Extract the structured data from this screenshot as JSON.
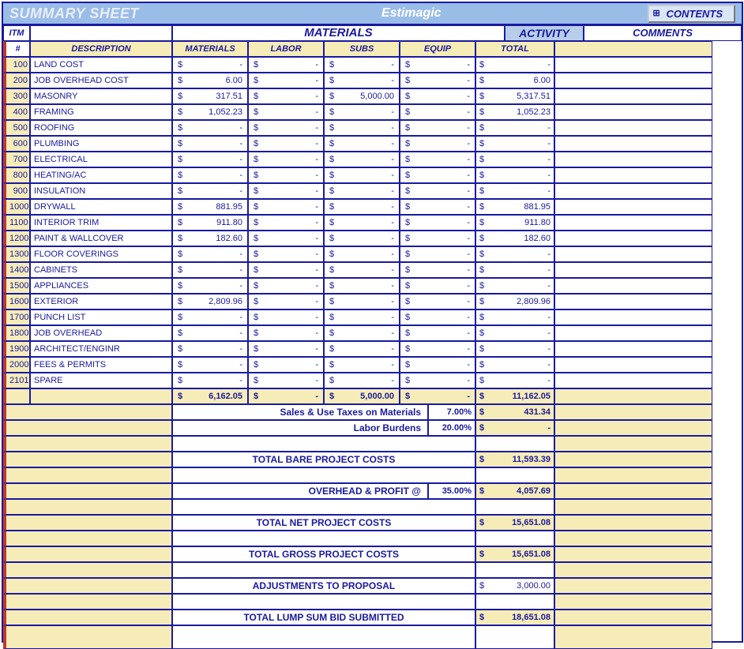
{
  "header": {
    "title": "SUMMARY SHEET",
    "app": "Estimagic",
    "button": "CONTENTS"
  },
  "colheads": {
    "itm": "ITM",
    "materials": "MATERIALS",
    "activity": "ACTIVITY",
    "comments": "COMMENTS",
    "num": "#",
    "desc": "DESCRIPTION",
    "c1": "MATERIALS",
    "c2": "LABOR",
    "c3": "SUBS",
    "c4": "EQUIP",
    "tot": "TOTAL"
  },
  "rows": [
    {
      "n": "100",
      "d": "LAND COST",
      "m": "-",
      "l": "-",
      "s": "-",
      "e": "-",
      "t": "-"
    },
    {
      "n": "200",
      "d": "JOB OVERHEAD COST",
      "m": "6.00",
      "l": "-",
      "s": "-",
      "e": "-",
      "t": "6.00"
    },
    {
      "n": "300",
      "d": "MASONRY",
      "m": "317.51",
      "l": "-",
      "s": "5,000.00",
      "e": "-",
      "t": "5,317.51"
    },
    {
      "n": "400",
      "d": "FRAMING",
      "m": "1,052.23",
      "l": "-",
      "s": "-",
      "e": "-",
      "t": "1,052.23"
    },
    {
      "n": "500",
      "d": "ROOFING",
      "m": "-",
      "l": "-",
      "s": "-",
      "e": "-",
      "t": "-"
    },
    {
      "n": "600",
      "d": "PLUMBING",
      "m": "-",
      "l": "-",
      "s": "-",
      "e": "-",
      "t": "-"
    },
    {
      "n": "700",
      "d": "ELECTRICAL",
      "m": "-",
      "l": "-",
      "s": "-",
      "e": "-",
      "t": "-"
    },
    {
      "n": "800",
      "d": "HEATING/AC",
      "m": "-",
      "l": "-",
      "s": "-",
      "e": "-",
      "t": "-"
    },
    {
      "n": "900",
      "d": "INSULATION",
      "m": "-",
      "l": "-",
      "s": "-",
      "e": "-",
      "t": "-"
    },
    {
      "n": "1000",
      "d": "DRYWALL",
      "m": "881.95",
      "l": "-",
      "s": "-",
      "e": "-",
      "t": "881.95"
    },
    {
      "n": "1100",
      "d": "INTERIOR TRIM",
      "m": "911.80",
      "l": "-",
      "s": "-",
      "e": "-",
      "t": "911.80"
    },
    {
      "n": "1200",
      "d": "PAINT & WALLCOVER",
      "m": "182.60",
      "l": "-",
      "s": "-",
      "e": "-",
      "t": "182.60"
    },
    {
      "n": "1300",
      "d": "FLOOR COVERINGS",
      "m": "-",
      "l": "-",
      "s": "-",
      "e": "-",
      "t": "-"
    },
    {
      "n": "1400",
      "d": "CABINETS",
      "m": "-",
      "l": "-",
      "s": "-",
      "e": "-",
      "t": "-"
    },
    {
      "n": "1500",
      "d": "APPLIANCES",
      "m": "-",
      "l": "-",
      "s": "-",
      "e": "-",
      "t": "-"
    },
    {
      "n": "1600",
      "d": "EXTERIOR",
      "m": "2,809.96",
      "l": "-",
      "s": "-",
      "e": "-",
      "t": "2,809.96"
    },
    {
      "n": "1700",
      "d": "PUNCH LIST",
      "m": "-",
      "l": "-",
      "s": "-",
      "e": "-",
      "t": "-"
    },
    {
      "n": "1800",
      "d": "JOB OVERHEAD",
      "m": "-",
      "l": "-",
      "s": "-",
      "e": "-",
      "t": "-"
    },
    {
      "n": "1900",
      "d": "ARCHITECT/ENGINR",
      "m": "-",
      "l": "-",
      "s": "-",
      "e": "-",
      "t": "-"
    },
    {
      "n": "2000",
      "d": "FEES & PERMITS",
      "m": "-",
      "l": "-",
      "s": "-",
      "e": "-",
      "t": "-"
    },
    {
      "n": "2101",
      "d": "SPARE",
      "m": "-",
      "l": "-",
      "s": "-",
      "e": "-",
      "t": "-"
    }
  ],
  "totals": {
    "m": "6,162.05",
    "l": "-",
    "s": "5,000.00",
    "e": "-",
    "t": "11,162.05"
  },
  "tax": {
    "label": "Sales & Use Taxes on Materials",
    "pct": "7.00%",
    "val": "431.34"
  },
  "burden": {
    "label": "Labor Burdens",
    "pct": "20.00%",
    "val": "-"
  },
  "lines": [
    {
      "label": "TOTAL BARE PROJECT COSTS",
      "val": "11,593.39",
      "yel": true
    },
    {
      "label": "OVERHEAD & PROFIT @",
      "pct": "35.00%",
      "val": "4,057.69",
      "yel": true
    },
    {
      "label": "TOTAL NET PROJECT COSTS",
      "val": "15,651.08",
      "yel": true
    },
    {
      "label": "TOTAL GROSS PROJECT COSTS",
      "val": "15,651.08",
      "yel": true
    },
    {
      "label": "ADJUSTMENTS TO PROPOSAL",
      "val": "3,000.00",
      "yel": false
    },
    {
      "label": "TOTAL LUMP SUM BID SUBMITTED",
      "val": "18,651.08",
      "yel": true
    }
  ]
}
